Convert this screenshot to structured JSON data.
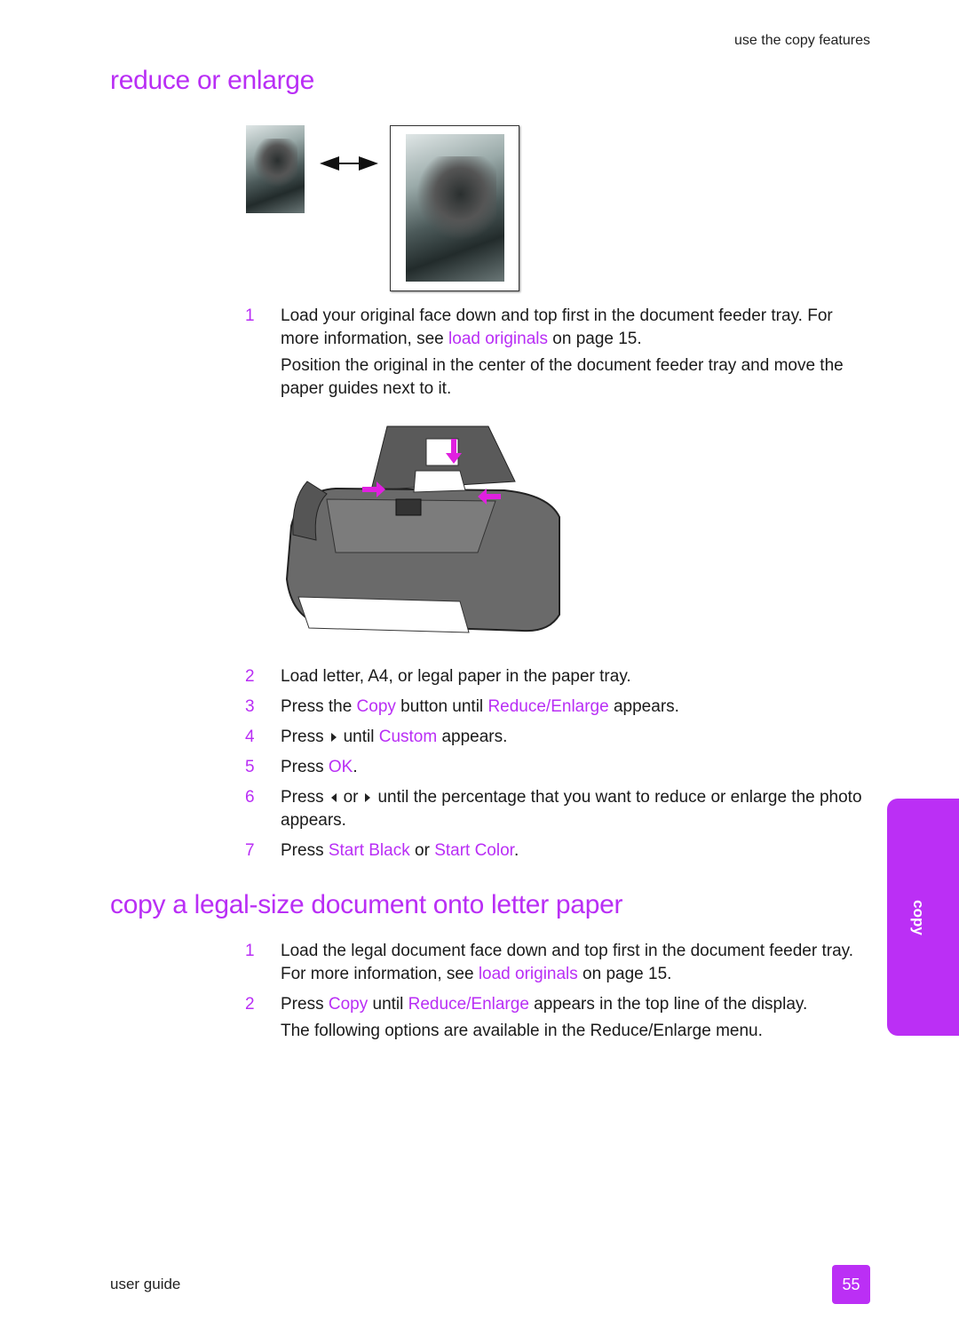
{
  "header": {
    "running_head": "use the copy features"
  },
  "section1": {
    "title": "reduce or enlarge",
    "illustration": {
      "small_image": "tiger-photo-small",
      "large_image": "tiger-photo-large",
      "arrow": "double-arrow-icon"
    },
    "step1": {
      "number": "1",
      "text_a": "Load your original face down and top first in the document feeder tray. For more information, see ",
      "link": "load originals",
      "text_b": " on page 15.",
      "note": "Position the original in the center of the document feeder tray and move the paper guides next to it."
    },
    "printer_illustration": "printer-with-document-feeder",
    "steps": [
      {
        "number": "2",
        "text": "Load letter, A4, or legal paper in the paper tray."
      },
      {
        "number": "3",
        "pre": "Press the ",
        "hl1": "Copy",
        "mid": " button until ",
        "hl2": "Reduce/Enlarge",
        "post": " appears."
      },
      {
        "number": "4",
        "pre": "Press",
        "mid": "until ",
        "hl1": "Custom",
        "post": " appears."
      },
      {
        "number": "5",
        "pre": "Press ",
        "hl1": "OK",
        "post": "."
      },
      {
        "number": "6",
        "pre": "Press",
        "mid": "or",
        "post": "until the percentage that you want to reduce or enlarge the photo appears."
      },
      {
        "number": "7",
        "pre": "Press ",
        "hl1": "Start Black",
        "mid": " or ",
        "hl2": "Start Color",
        "post": "."
      }
    ]
  },
  "section2": {
    "title": "copy a legal-size document onto letter paper",
    "steps": [
      {
        "number": "1",
        "pre": "Load the legal document face down and top first in the document feeder tray. For more information, see ",
        "hl1": "load originals",
        "post": " on page 15."
      },
      {
        "number": "2",
        "pre": "Press ",
        "hl1": "Copy",
        "mid": " until ",
        "hl2": "Reduce/Enlarge",
        "post": " appears in the top line of the display.",
        "note": "The following options are available in the Reduce/Enlarge menu."
      }
    ]
  },
  "side_tab": {
    "label": "copy"
  },
  "footer": {
    "left": "user guide",
    "page_number": "55"
  },
  "colors": {
    "accent": "#bb2ff5",
    "text": "#1a1a1a"
  }
}
